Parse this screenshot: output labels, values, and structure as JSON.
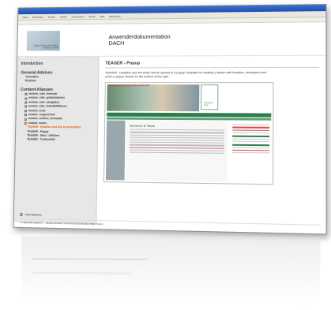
{
  "menubar": [
    "Datei",
    "Bearbeiten",
    "Ansicht",
    "Verlauf",
    "Lesezeichen",
    "Extras",
    "Hilfe",
    "Menüpunkt"
  ],
  "logo": {
    "text": "Quality Services and Tooling Solutions at Work"
  },
  "header": {
    "title_line1": "Anwenderdokumentation",
    "title_line2": "DACH"
  },
  "sidebar": {
    "intro": "Introduction",
    "general_title": "General Advices",
    "general_items": [
      "Textedtion",
      "RssDots"
    ],
    "content_title": "Content-Klassen",
    "items": [
      "module_sdm_formular",
      "module_sdm_globalelabelsn",
      "module_sdm_navigation",
      "module_sdm_SmartEditBoxen",
      "module_tools",
      "module_rssgenerical",
      "module_content_formulare",
      "module_teaser"
    ],
    "active_item": "TEASER - Headline und link or description",
    "sub_items": [
      "TEASER - Popup",
      "TEASER - Start - AllInOne",
      "TEASER - Toolboxbild"
    ]
  },
  "content": {
    "title": "TEASER - Popup",
    "description": "TEASER - Headline and link which will be opened in a popup Template for creating a teaser with headline, description and a link or popup Teaser for the toolbox at the right."
  },
  "screenshot": {
    "photo_label": "P-Teaser-Popup Services & Tools Sondertitel 360",
    "tile_label": "Services & Tools",
    "main_title": "Services & Tools"
  },
  "footer": {
    "info": "Informationen",
    "copyright": "© 1999-2008 MEDIAN. - GESELLSCHAFT FÜR DIGITALE MEDIEN MBH, KÖLN"
  },
  "colors": {
    "accent": "#e05a00",
    "green": "#2f7c4e",
    "sidebar_bg": "#e7e7e7"
  }
}
